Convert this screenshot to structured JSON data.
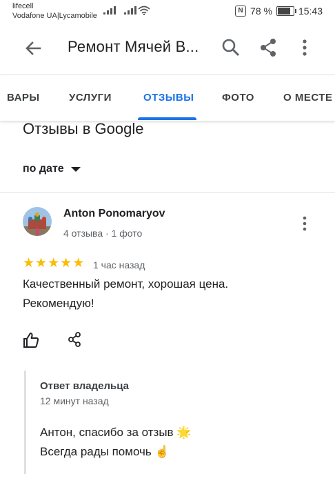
{
  "status_bar": {
    "carrier_1": "lifecell",
    "carrier_2": "Vodafone UA|Lycamobile",
    "nfc_label": "N",
    "battery": "78 %",
    "time": "15:43"
  },
  "app_bar": {
    "title": "Ремонт Мячей В...",
    "back_icon": "arrow-back-icon",
    "search_icon": "search-icon",
    "share_icon": "share-icon",
    "more_icon": "more-vert-icon"
  },
  "tabs": [
    {
      "label": "ВАРЫ",
      "active": false
    },
    {
      "label": "УСЛУГИ",
      "active": false
    },
    {
      "label": "ОТЗЫВЫ",
      "active": true
    },
    {
      "label": "ФОТО",
      "active": false
    },
    {
      "label": "О МЕСТЕ",
      "active": false
    }
  ],
  "reviews_section": {
    "title": "Отзывы в Google",
    "sort_label": "по дате"
  },
  "review": {
    "author": "Anton Ponomaryov",
    "meta": "4 отзыва · 1 фото",
    "rating": 5,
    "time": "1 час назад",
    "text_line_1": "Качественный ремонт, хорошая цена.",
    "text_line_2": "Рекомендую!",
    "like_icon": "thumb-up-icon",
    "share_icon": "share-icon"
  },
  "owner_reply": {
    "heading": "Ответ владельца",
    "time": "12 минут назад",
    "line_1": "Антон, спасибо за отзыв",
    "emoji_1": "🌟",
    "line_2": "Всегда рады помочь",
    "emoji_2": "☝️"
  },
  "colors": {
    "accent": "#1a73e8",
    "star": "#fbbc04",
    "text": "#202124",
    "secondary_text": "#5f6368"
  }
}
